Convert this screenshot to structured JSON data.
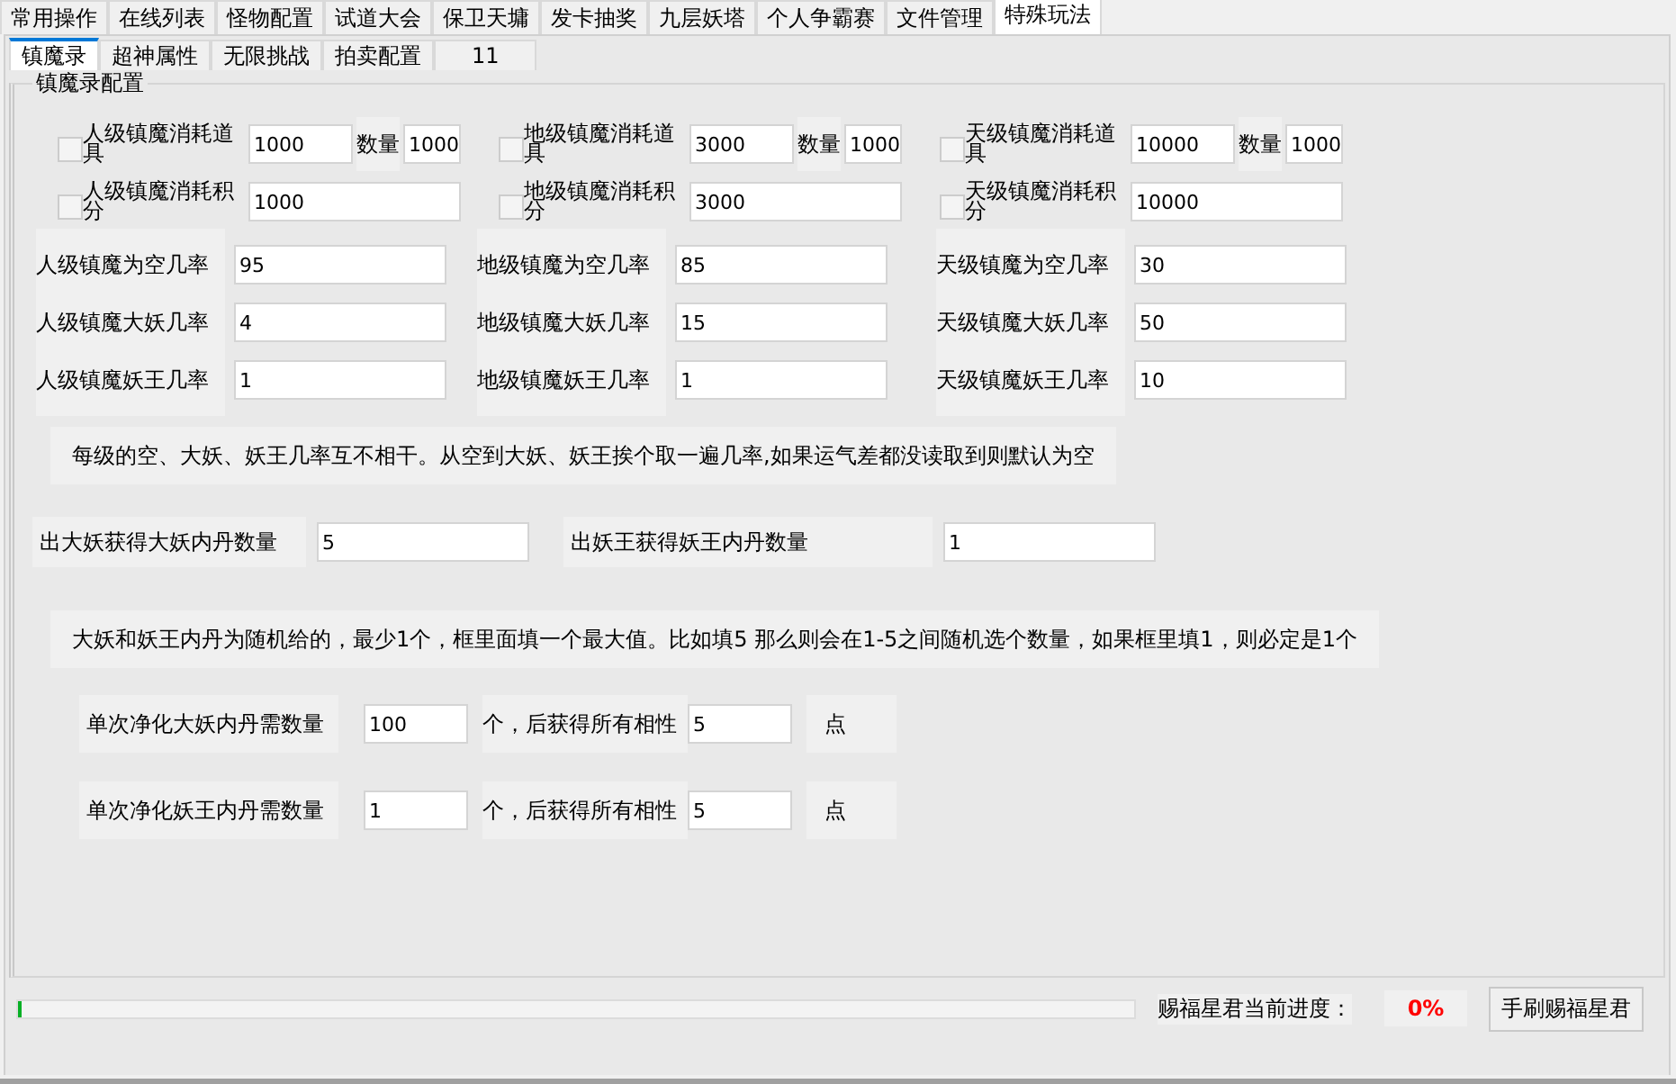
{
  "main_tabs": [
    {
      "label": "常用操作",
      "selected": false
    },
    {
      "label": "在线列表",
      "selected": false
    },
    {
      "label": "怪物配置",
      "selected": false
    },
    {
      "label": "试道大会",
      "selected": false
    },
    {
      "label": "保卫天墉",
      "selected": false
    },
    {
      "label": "发卡抽奖",
      "selected": false
    },
    {
      "label": "九层妖塔",
      "selected": false
    },
    {
      "label": "个人争霸赛",
      "selected": false
    },
    {
      "label": "文件管理",
      "selected": false
    },
    {
      "label": "特殊玩法",
      "selected": true
    }
  ],
  "sub_tabs": [
    {
      "label": "镇魔录",
      "selected": true
    },
    {
      "label": "超神属性",
      "selected": false
    },
    {
      "label": "无限挑战",
      "selected": false
    },
    {
      "label": "拍卖配置",
      "selected": false
    },
    {
      "label": "11",
      "selected": false
    }
  ],
  "group_title": "镇魔录配置",
  "tiers": [
    {
      "item_checkbox": {
        "label": "人级镇魔消耗道具",
        "checked": false
      },
      "item_value": "1000",
      "qty_label": "数量",
      "qty_value": "1000",
      "points_checkbox": {
        "label": "人级镇魔消耗积分",
        "checked": false
      },
      "points_value": "1000",
      "rates": [
        {
          "label": "人级镇魔为空几率",
          "value": "95"
        },
        {
          "label": "人级镇魔大妖几率",
          "value": "4"
        },
        {
          "label": "人级镇魔妖王几率",
          "value": "1"
        }
      ]
    },
    {
      "item_checkbox": {
        "label": "地级镇魔消耗道具",
        "checked": false
      },
      "item_value": "3000",
      "qty_label": "数量",
      "qty_value": "1000",
      "points_checkbox": {
        "label": "地级镇魔消耗积分",
        "checked": false
      },
      "points_value": "3000",
      "rates": [
        {
          "label": "地级镇魔为空几率",
          "value": "85"
        },
        {
          "label": "地级镇魔大妖几率",
          "value": "15"
        },
        {
          "label": "地级镇魔妖王几率",
          "value": "1"
        }
      ]
    },
    {
      "item_checkbox": {
        "label": "天级镇魔消耗道具",
        "checked": false
      },
      "item_value": "10000",
      "qty_label": "数量",
      "qty_value": "1000",
      "points_checkbox": {
        "label": "天级镇魔消耗积分",
        "checked": false
      },
      "points_value": "10000",
      "rates": [
        {
          "label": "天级镇魔为空几率",
          "value": "30"
        },
        {
          "label": "天级镇魔大妖几率",
          "value": "50"
        },
        {
          "label": "天级镇魔妖王几率",
          "value": "10"
        }
      ]
    }
  ],
  "note_1": "每级的空、大妖、妖王几率互不相干。从空到大妖、妖王挨个取一遍几率,如果运气差都没读取到则默认为空",
  "core_fields": [
    {
      "label": "出大妖获得大妖内丹数量",
      "value": "5"
    },
    {
      "label": "出妖王获得妖王内丹数量",
      "value": "1"
    }
  ],
  "note_2": "大妖和妖王内丹为随机给的，最少1个，框里面填一个最大值。比如填5 那么则会在1-5之间随机选个数量，如果框里填1，则必定是1个",
  "purify_rows": [
    {
      "label": "单次净化大妖内丹需数量",
      "value": "100",
      "mid_label": "个，后获得所有相性",
      "value2": "5",
      "unit": "点"
    },
    {
      "label": "单次净化妖王内丹需数量",
      "value": "1",
      "mid_label": "个，后获得所有相性",
      "value2": "5",
      "unit": "点"
    }
  ],
  "progress": {
    "level": 0,
    "label": "赐福星君当前进度：",
    "value": "0%"
  },
  "refresh_button": "手刷赐福星君"
}
